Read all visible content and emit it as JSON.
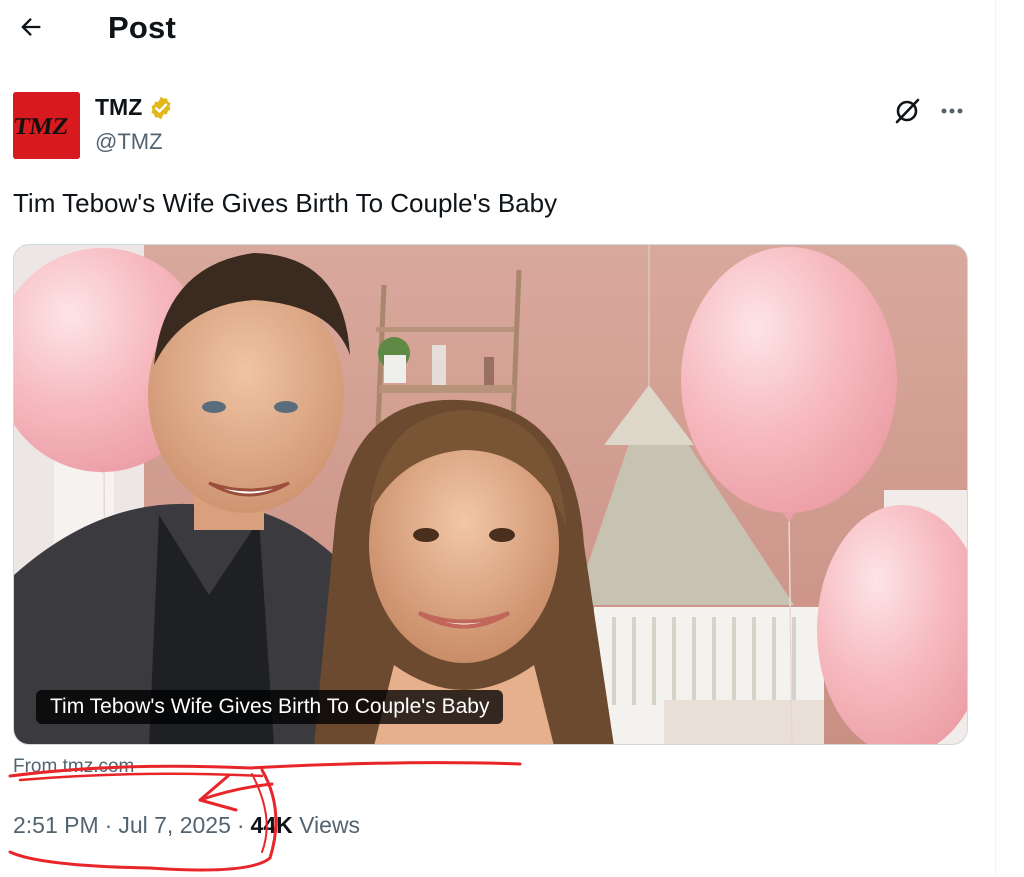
{
  "header": {
    "title": "Post"
  },
  "author": {
    "name": "TMZ",
    "handle": "@TMZ",
    "avatar_text": "TMZ",
    "verified": true
  },
  "tweet": {
    "text": "Tim Tebow's Wife Gives Birth To Couple's Baby"
  },
  "card": {
    "caption": "Tim Tebow's Wife Gives Birth To Couple's Baby",
    "source": "From tmz.com"
  },
  "meta": {
    "time": "2:51 PM",
    "date": "Jul 7, 2025",
    "separator": "·",
    "views_count": "44K",
    "views_label": "Views"
  },
  "icons": {
    "back": "arrow-left-icon",
    "verified": "verified-badge-icon",
    "grok": "grok-icon",
    "more": "more-horizontal-icon"
  },
  "colors": {
    "text_primary": "#0f1419",
    "text_secondary": "#536471",
    "verified_gold": "#e2b719",
    "avatar_red": "#d71920",
    "annotation_red": "#e8262a"
  }
}
